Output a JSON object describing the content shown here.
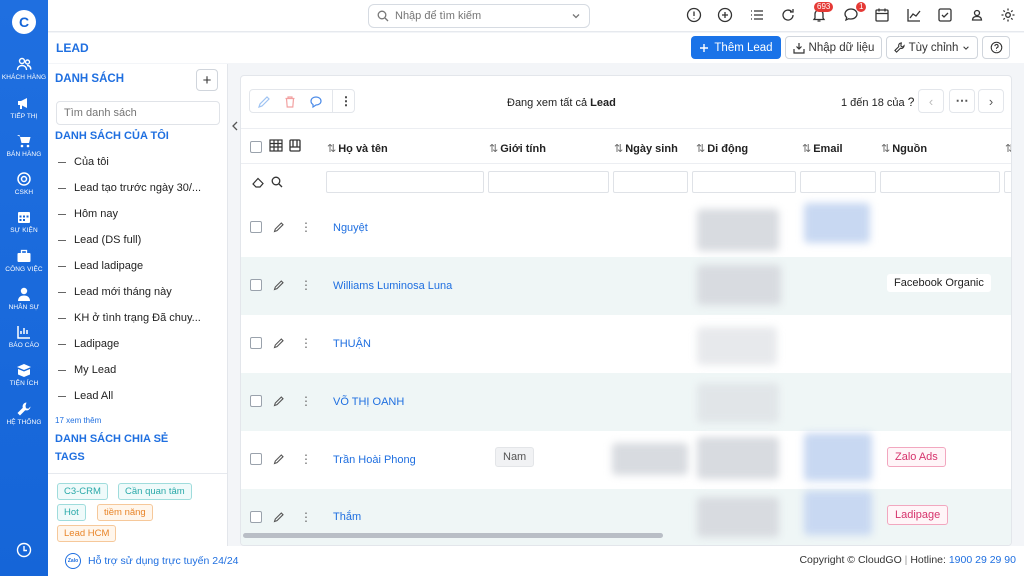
{
  "rail": {
    "logo": "C",
    "items": [
      {
        "label": "KHÁCH HÀNG",
        "icon": "users-icon"
      },
      {
        "label": "TIẾP THỊ",
        "icon": "megaphone-icon"
      },
      {
        "label": "BÁN HÀNG",
        "icon": "cart-icon"
      },
      {
        "label": "CSKH",
        "icon": "support-icon"
      },
      {
        "label": "SỰ KIỆN",
        "icon": "calendar-icon"
      },
      {
        "label": "CÔNG VIỆC",
        "icon": "briefcase-icon"
      },
      {
        "label": "NHÂN SỰ",
        "icon": "person-icon"
      },
      {
        "label": "BÁO CÁO",
        "icon": "report-icon"
      },
      {
        "label": "TIỆN ÍCH",
        "icon": "box-icon"
      },
      {
        "label": "HỆ THỐNG",
        "icon": "wrench-icon"
      }
    ]
  },
  "topbar": {
    "search_placeholder": "Nhập để tìm kiếm",
    "notifications_count": "693",
    "messages_count": "1"
  },
  "header": {
    "title": "LEAD",
    "add_button": "Thêm Lead",
    "import_button": "Nhập dữ liệu",
    "customize_button": "Tùy chỉnh"
  },
  "sidebar": {
    "heading": "DANH SÁCH",
    "search_placeholder": "Tìm danh sách",
    "my_lists_heading": "DANH SÁCH CỦA TÔI",
    "items": [
      "Của tôi",
      "Lead tạo trước ngày 30/...",
      "Hôm nay",
      "Lead (DS full)",
      "Lead ladipage",
      "Lead mới tháng này",
      "KH ở tình trạng Đã chuy...",
      "Ladipage",
      "My Lead",
      "Lead All"
    ],
    "more_link": "17 xem thêm",
    "shared_heading": "DANH SÁCH CHIA SẺ",
    "tags_heading": "TAGS",
    "tags": [
      {
        "label": "C3-CRM",
        "color": "#2aa9a9"
      },
      {
        "label": "Cần quan tâm",
        "color": "#2aa9a9"
      },
      {
        "label": "Hot",
        "color": "#2aa9a9"
      },
      {
        "label": "tiềm năng",
        "color": "#f0932b"
      },
      {
        "label": "Lead HCM",
        "color": "#f0932b"
      }
    ]
  },
  "table": {
    "viewing_prefix": "Đang xem tất cả",
    "viewing_module": "Lead",
    "page_info": "1 đến 18 của",
    "page_info_q": "?",
    "columns": [
      "Họ và tên",
      "Giới tính",
      "Ngày sinh",
      "Di động",
      "Email",
      "Nguồn"
    ],
    "rows": [
      {
        "name": "Nguyệt",
        "gender": "",
        "source": ""
      },
      {
        "name": "Williams Luminosa Luna",
        "gender": "",
        "source": "Facebook Organic"
      },
      {
        "name": "THUẬN",
        "gender": "",
        "source": ""
      },
      {
        "name": "VÕ THỊ OANH",
        "gender": "",
        "source": ""
      },
      {
        "name": "Trần Hoài Phong",
        "gender": "Nam",
        "source": "Zalo Ads"
      },
      {
        "name": "Thắm",
        "gender": "",
        "source": "Ladipage"
      }
    ]
  },
  "footer": {
    "zalo": "Zalo",
    "support": "Hỗ trợ sử dụng trực tuyến 24/24",
    "copyright": "Copyright © CloudGO",
    "hotline_label": "Hotline:",
    "hotline": "1900 29 29 90"
  },
  "colors": {
    "brand": "#1f6fe0",
    "tag_teal": "#2aa9a9",
    "tag_orange": "#f0932b",
    "chip_red": "#d6336c"
  }
}
